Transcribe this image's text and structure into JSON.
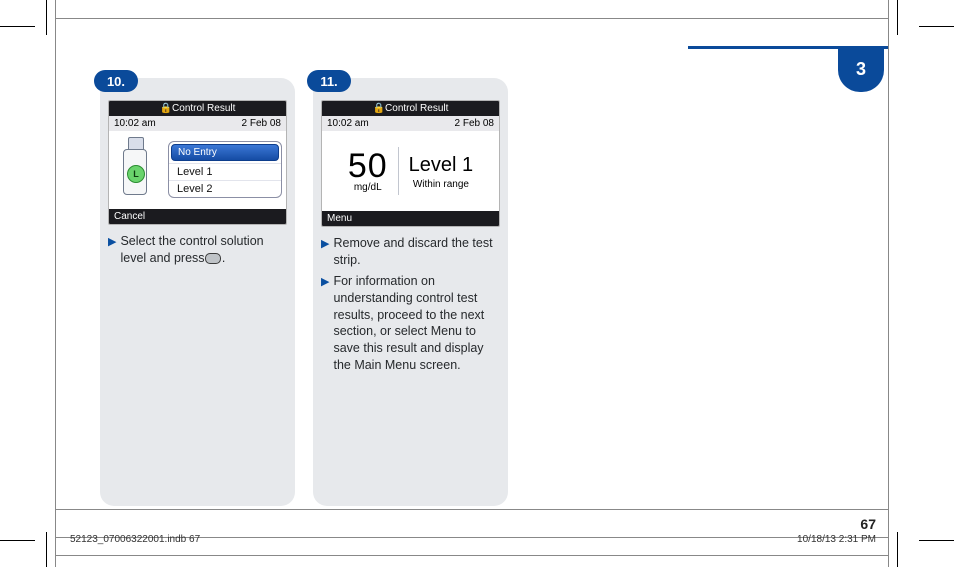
{
  "chapter_tab": "3",
  "page_number": "67",
  "footer_left": "52123_07006322001.indb   67",
  "footer_right": "10/18/13   2:31 PM",
  "steps": [
    {
      "badge": "10.",
      "screen": {
        "title": "Control Result",
        "time": "10:02 am",
        "date": "2 Feb 08",
        "bottle_letter": "L",
        "menu_header": "No Entry",
        "menu_opt1": "Level 1",
        "menu_opt2": "Level 2",
        "softkey": "Cancel"
      },
      "instructions": [
        "Select the control solution level and press     ."
      ]
    },
    {
      "badge": "11.",
      "screen": {
        "title": "Control Result",
        "time": "10:02 am",
        "date": "2 Feb 08",
        "value": "50",
        "unit": "mg/dL",
        "level": "Level 1",
        "range": "Within range",
        "softkey": "Menu"
      },
      "instructions": [
        "Remove and discard the test strip.",
        "For information on understanding control test results, proceed to the next section, or select Menu to save this result and display the Main Menu screen."
      ]
    }
  ]
}
